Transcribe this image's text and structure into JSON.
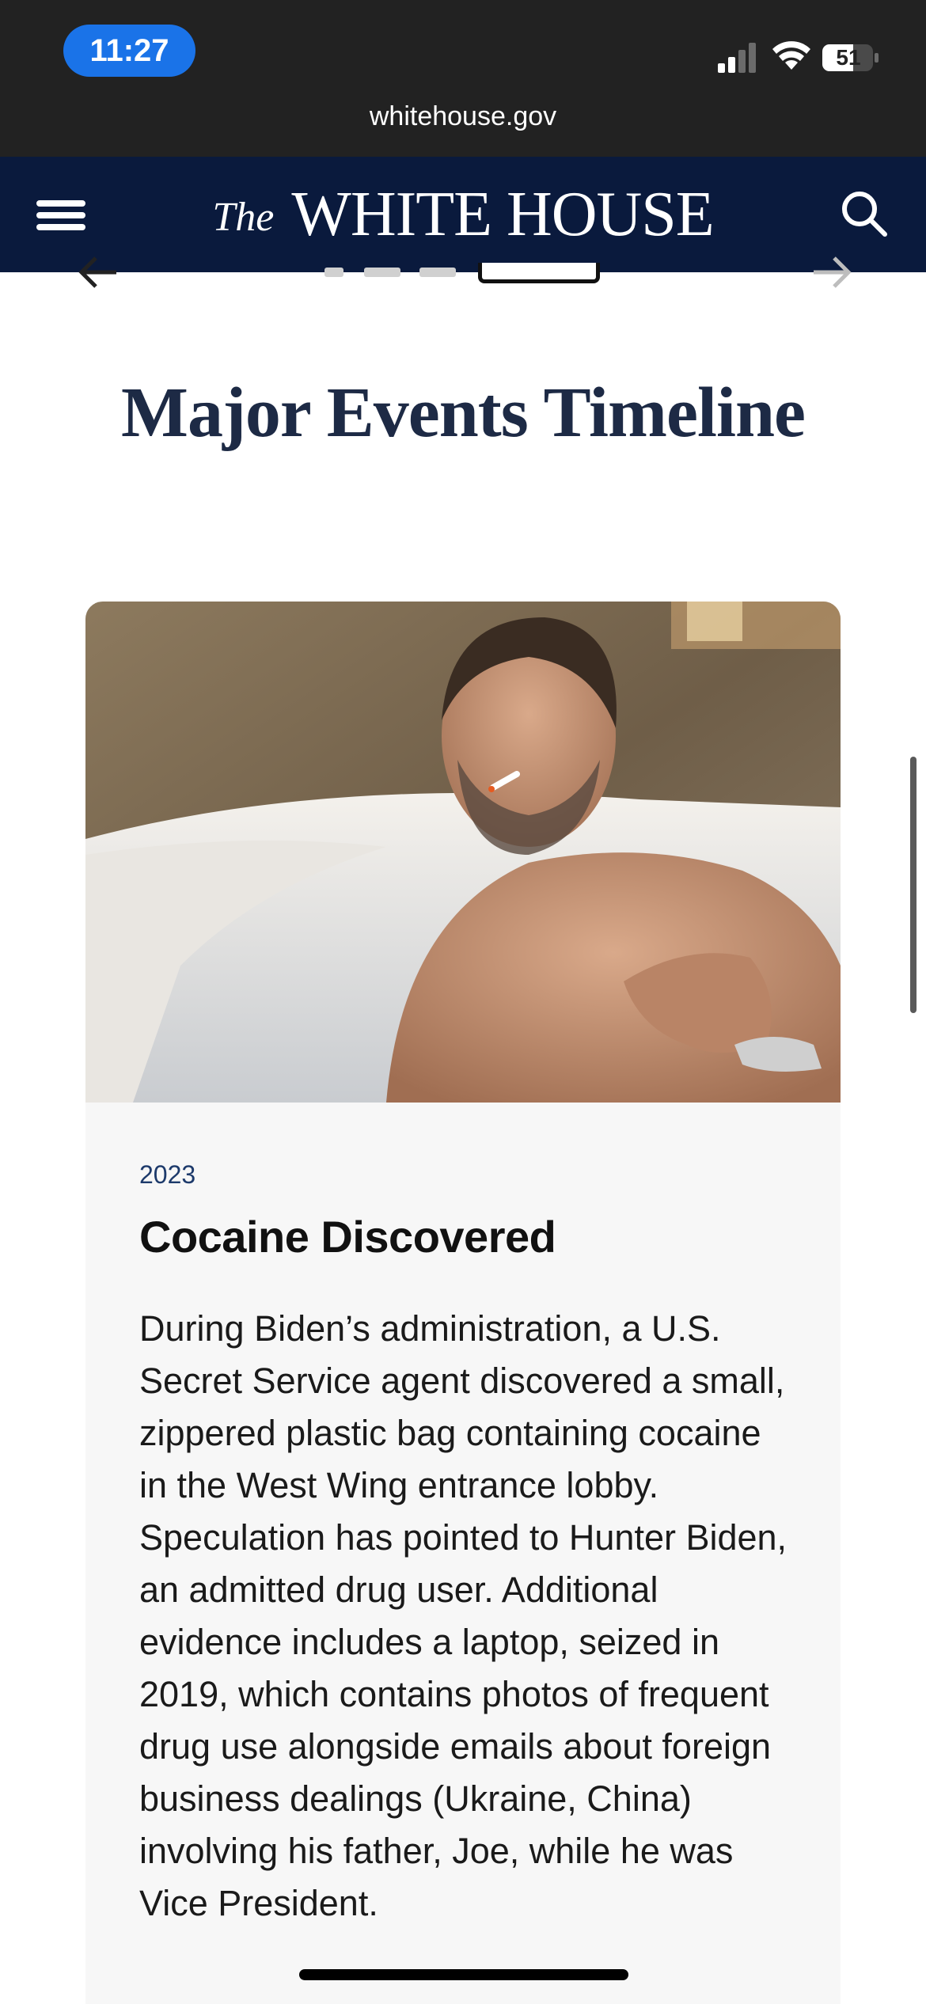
{
  "status_bar": {
    "time": "11:27",
    "battery": "51",
    "accent_color": "#1a73e8",
    "icons": [
      "signal-icon",
      "wifi-icon",
      "battery-icon"
    ]
  },
  "browser": {
    "url": "whitehouse.gov"
  },
  "header": {
    "brand_prefix": "The",
    "brand_name": "WHITE HOUSE",
    "background_color": "#0a1a3d",
    "icons": [
      "menu-icon",
      "search-icon"
    ]
  },
  "carousel": {
    "icons": [
      "arrow-left-icon",
      "arrow-right-icon"
    ],
    "dots_total": 4,
    "active_dot": 4
  },
  "timeline": {
    "title": "Major Events Timeline"
  },
  "card": {
    "year": "2023",
    "title": "Cocaine Discovered",
    "body": "During Biden’s administration, a U.S. Secret Service agent discovered a small, zippered plastic bag containing cocaine in the West Wing entrance lobby. Speculation has pointed to Hunter Biden, an admitted drug user. Additional evidence includes a laptop, seized in 2019, which contains photos of frequent drug use alongside emails about foreign business dealings (Ukraine, China) involving his father, Joe, while he was Vice President."
  }
}
